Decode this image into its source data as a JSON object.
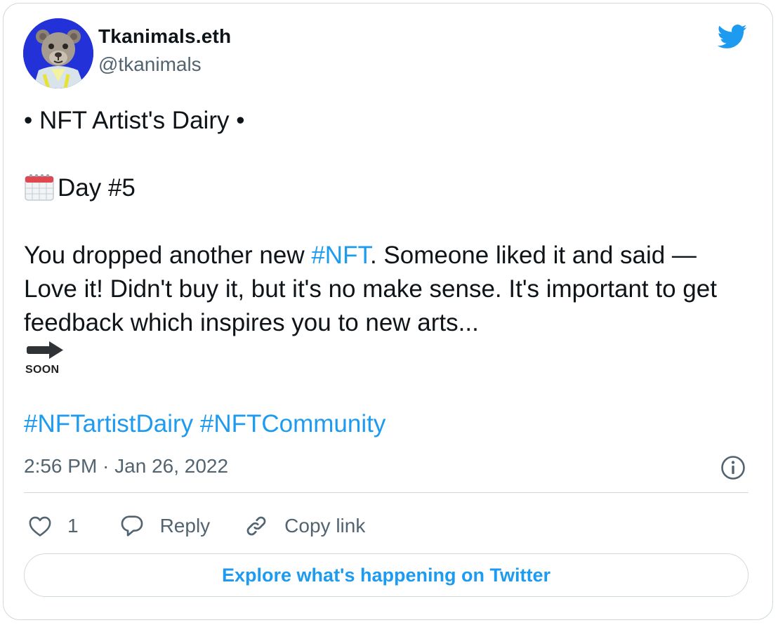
{
  "author": {
    "name": "Tkanimals.eth",
    "handle": "@tkanimals",
    "avatar_icon": "bear-avatar-icon"
  },
  "tweet": {
    "line1": "• NFT Artist's Dairy •",
    "day": "Day #5",
    "body_part1": "You dropped another new ",
    "body_hashtag": "#NFT",
    "body_part2": ". Someone liked it and said — Love it! Didn't buy it, but it's no make sense. It's important to get feedback which inspires you to new arts...",
    "soon_label": "SOON",
    "hashtag1": "#NFTartistDairy",
    "hashtag2": "#NFTCommunity"
  },
  "meta": {
    "timestamp": "2:56 PM · Jan 26, 2022"
  },
  "actions": {
    "like_count": "1",
    "reply_label": "Reply",
    "copy_label": "Copy link"
  },
  "footer": {
    "explore_label": "Explore what's happening on Twitter"
  },
  "colors": {
    "accent": "#1d9bf0",
    "text": "#0f1419",
    "secondary": "#536471",
    "border": "#cfd9de"
  }
}
